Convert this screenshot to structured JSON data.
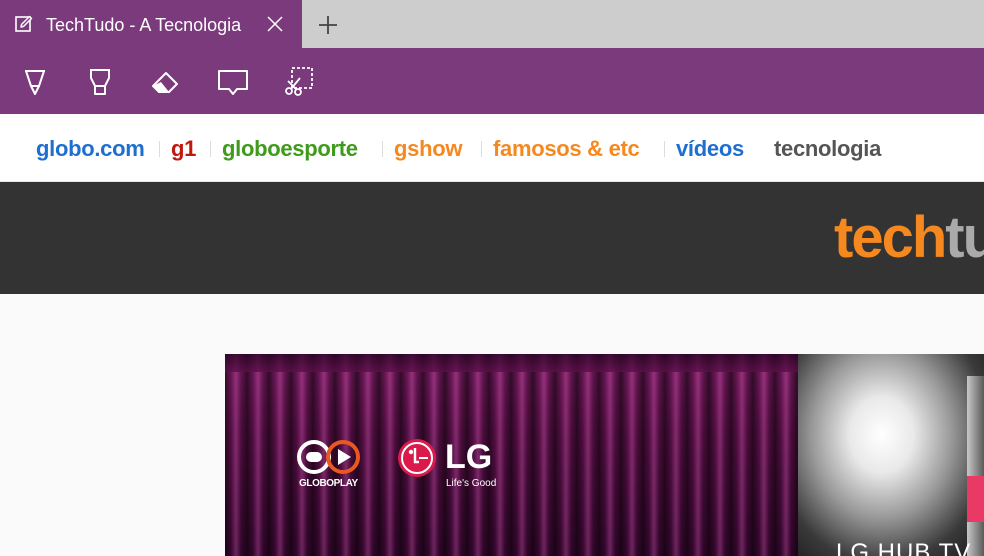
{
  "browser": {
    "tab": {
      "title": "TechTudo - A Tecnologia",
      "icon": "note-edit-icon",
      "close_icon": "close-icon"
    },
    "new_tab_icon": "plus-icon",
    "accent_color": "#7a3a7c",
    "toolbar": {
      "tools": [
        {
          "name": "pen",
          "icon": "pen-icon"
        },
        {
          "name": "highlighter",
          "icon": "highlighter-icon"
        },
        {
          "name": "eraser",
          "icon": "eraser-icon"
        },
        {
          "name": "add-note",
          "icon": "comment-icon"
        },
        {
          "name": "clip",
          "icon": "clip-scissors-icon"
        }
      ]
    }
  },
  "globo_nav": {
    "items": [
      {
        "label": "globo.com",
        "color": "#1e6fd0"
      },
      {
        "label": "g1",
        "color": "#c4170c"
      },
      {
        "label": "globoesporte",
        "color": "#3e9b1b"
      },
      {
        "label": "gshow",
        "color": "#f5891f"
      },
      {
        "label": "famosos & etc",
        "color": "#f5891f"
      },
      {
        "label": "vídeos",
        "color": "#1e6fd0"
      },
      {
        "label": "tecnologia",
        "color": "#555555"
      }
    ]
  },
  "site_header": {
    "logo_part1": "tech",
    "logo_part2": "tu",
    "logo_color1": "#f5891f",
    "logo_color2": "#aaaaaa",
    "background": "#333333"
  },
  "banner": {
    "globoplay_label": "GLOBOPLAY",
    "lg_name": "LG",
    "lg_tagline": "Life's Good",
    "caption": "LG HUB TV"
  }
}
